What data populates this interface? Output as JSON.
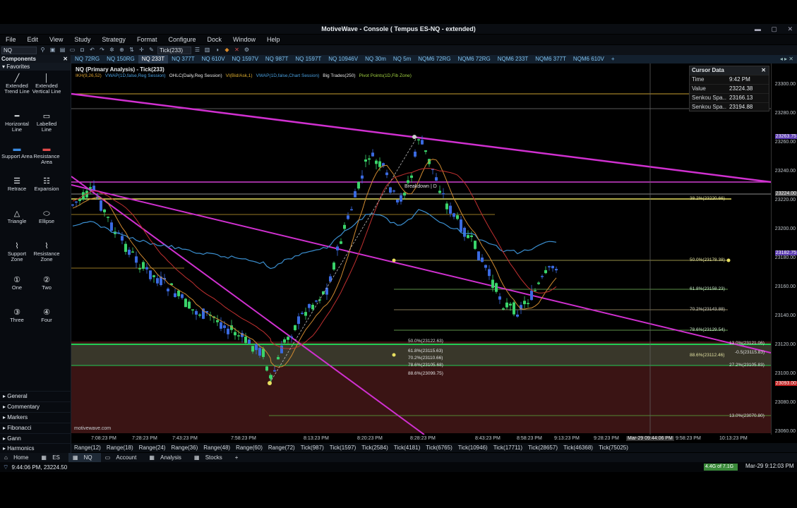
{
  "window": {
    "title": "MotiveWave - Console ( Tempus ES-NQ - extended)"
  },
  "menu": [
    "File",
    "Edit",
    "View",
    "Study",
    "Strategy",
    "Format",
    "Configure",
    "Dock",
    "Window",
    "Help"
  ],
  "toolbar": {
    "symbol": "NQ",
    "bar_size": "Tick(233)"
  },
  "left_panel": {
    "header": "Components",
    "favorites_label": "Favorites",
    "tools": [
      {
        "label": "Extended Trend Line",
        "icon": "trend-line-icon"
      },
      {
        "label": "Extended Vertical Line",
        "icon": "vertical-line-icon"
      },
      {
        "label": "Horizontal Line",
        "icon": "horizontal-line-icon"
      },
      {
        "label": "Labelled Line",
        "icon": "labelled-line-icon"
      },
      {
        "label": "Support Area",
        "icon": "support-area-icon"
      },
      {
        "label": "Resistance Area",
        "icon": "resistance-area-icon"
      },
      {
        "label": "Retrace",
        "icon": "retrace-icon"
      },
      {
        "label": "Expansion",
        "icon": "expansion-icon"
      },
      {
        "label": "Triangle",
        "icon": "triangle-icon"
      },
      {
        "label": "Ellipse",
        "icon": "ellipse-icon"
      },
      {
        "label": "Support Zone",
        "icon": "support-zone-icon"
      },
      {
        "label": "Resistance Zone",
        "icon": "resistance-zone-icon"
      },
      {
        "label": "One",
        "icon": "1"
      },
      {
        "label": "Two",
        "icon": "2"
      },
      {
        "label": "Three",
        "icon": "3"
      },
      {
        "label": "Four",
        "icon": "4"
      }
    ],
    "sections": [
      "General",
      "Commentary",
      "Markers",
      "Fibonacci",
      "Gann",
      "Harmonics"
    ]
  },
  "chart_tabs": [
    "NQ 72RG",
    "NQ 150RG",
    "NQ 233T",
    "NQ 377T",
    "NQ 610V",
    "NQ 1597V",
    "NQ 987T",
    "NQ 1597T",
    "NQ 10946V",
    "NQ 30m",
    "NQ 5m",
    "NQM6 72RG",
    "NQM6 72RG",
    "NQM6 233T",
    "NQM6 377T",
    "NQM6 610V"
  ],
  "active_tab": "NQ 233T",
  "chart": {
    "title": "NQ (Primary Analysis) - Tick(233)",
    "indicators": [
      {
        "text": "IKH(9,26,52)",
        "color": "#d9a030"
      },
      {
        "text": "VWAP(1D,false,Reg Session)",
        "color": "#4aa0e0"
      },
      {
        "text": "OHLC(Daily,Reg Session)",
        "color": "#e8e8e8"
      },
      {
        "text": "VI(Bid/Ask,1)",
        "color": "#e0b030"
      },
      {
        "text": "VWAP(1D,false,Chart Session)",
        "color": "#4aa0e0"
      },
      {
        "text": "Big Trades(250)",
        "color": "#e8e8e8"
      },
      {
        "text": "Pivot Points(1D,Fib Zone)",
        "color": "#a0d040"
      }
    ],
    "watermark": "motivewave.com",
    "annotation": "Breakdown | D",
    "fib_labels_right": [
      "38.2%(23220.66)",
      "50.0%(23178.38)",
      "61.8%(23158.23)",
      "70.2%(23143.88)",
      "78.6%(23129.54)",
      "13.0%(23121.06)",
      "88.6%(23112.46)",
      "-0.5(23115.83)",
      "27.2%(23105.83)",
      "13.0%(23070.80)"
    ],
    "fib_labels_mid": [
      "50.0%(23122.63)",
      "61.8%(23115.63)",
      "70.2%(23110.66)",
      "78.6%(23105.68)",
      "88.6%(23099.75)"
    ]
  },
  "cursor_data": {
    "title": "Cursor Data",
    "rows": [
      {
        "key": "Time",
        "value": "9:42 PM"
      },
      {
        "key": "Value",
        "value": "23224.38"
      },
      {
        "key": "Senkou Spa...",
        "value": "23166.13"
      },
      {
        "key": "Senkou Spa...",
        "value": "23194.88"
      }
    ]
  },
  "y_axis": {
    "labels": [
      "23300.00",
      "23280.00",
      "23260.00",
      "23240.00",
      "23220.00",
      "23200.00",
      "23180.00",
      "23160.00",
      "23140.00",
      "23120.00",
      "23100.00",
      "23080.00",
      "23060.00"
    ],
    "badges": [
      {
        "text": "23263.75",
        "color": "#5a3ab0"
      },
      {
        "text": "23224.00",
        "color": "#555555"
      },
      {
        "text": "23182.75",
        "color": "#5a3ab0"
      },
      {
        "text": "23093.00",
        "color": "#c02020"
      }
    ]
  },
  "x_axis": {
    "labels": [
      "7:08:23 PM",
      "7:28:23 PM",
      "7:43:23 PM",
      "7:58:23 PM",
      "8:13:23 PM",
      "8:20:23 PM",
      "8:28:23 PM",
      "8:43:23 PM",
      "8:58:23 PM",
      "9:13:23 PM",
      "9:28:23 PM",
      "Mar-29 09:44:06 PM",
      "9:58:23 PM",
      "10:13:23 PM"
    ]
  },
  "range_bar": [
    "Range(12)",
    "Range(18)",
    "Range(24)",
    "Range(36)",
    "Range(48)",
    "Range(60)",
    "Range(72)",
    "Tick(987)",
    "Tick(1597)",
    "Tick(2584)",
    "Tick(4181)",
    "Tick(6765)",
    "Tick(10946)",
    "Tick(17711)",
    "Tick(28657)",
    "Tick(46368)",
    "Tick(75025)"
  ],
  "bottom_tabs": [
    "Home",
    "ES",
    "NQ",
    "Account",
    "Analysis",
    "Stocks",
    "+"
  ],
  "status": {
    "left": "9:44:06 PM, 23224.50",
    "memory": "4.4G of 7.1G",
    "clock": "Mar-29 9:12:03 PM"
  }
}
